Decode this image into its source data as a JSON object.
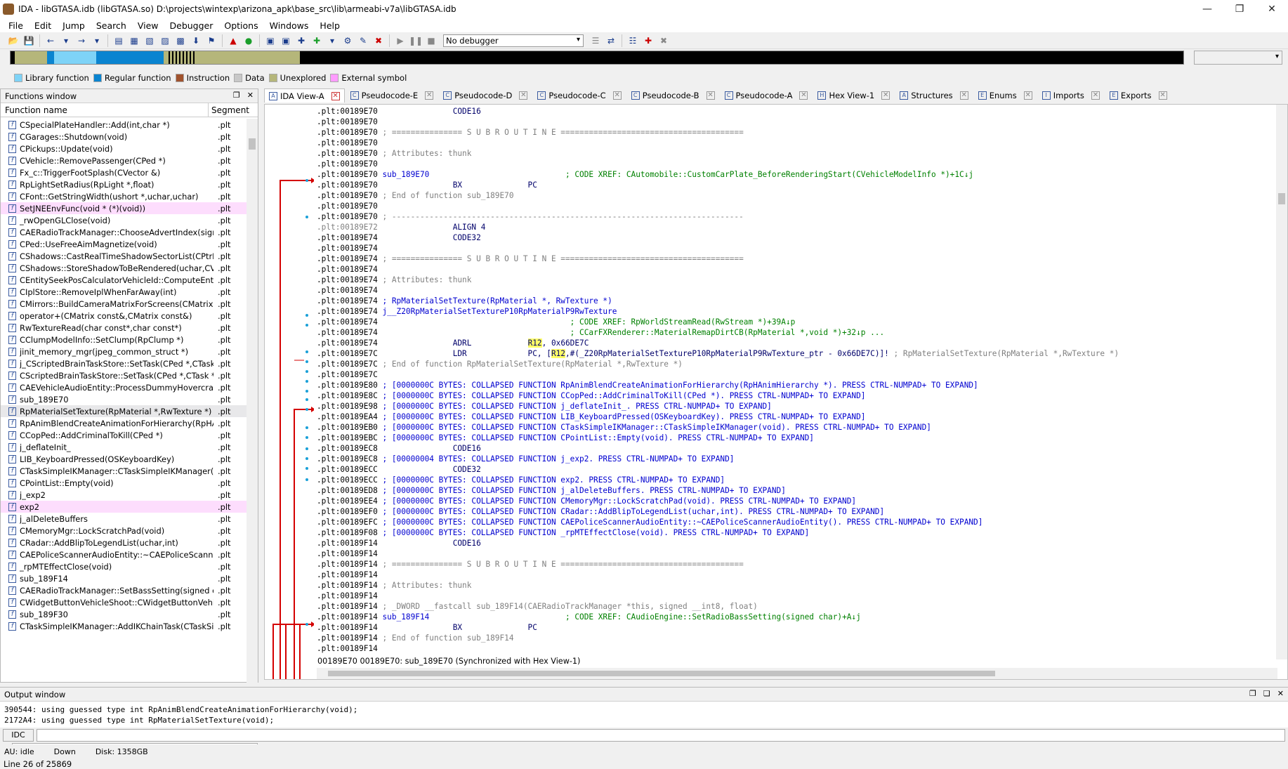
{
  "window": {
    "title": "IDA - libGTASA.idb (libGTASA.so) D:\\projects\\wintexp\\arizona_apk\\base_src\\lib\\armeabi-v7a\\libGTASA.idb"
  },
  "menu": [
    "File",
    "Edit",
    "Jump",
    "Search",
    "View",
    "Debugger",
    "Options",
    "Windows",
    "Help"
  ],
  "toolbar": {
    "debugger_select": "No debugger"
  },
  "legend": [
    {
      "label": "Library function",
      "color": "#7ed3f7"
    },
    {
      "label": "Regular function",
      "color": "#0a84d0"
    },
    {
      "label": "Instruction",
      "color": "#a0522d"
    },
    {
      "label": "Data",
      "color": "#c8c8c8"
    },
    {
      "label": "Unexplored",
      "color": "#b5b67a"
    },
    {
      "label": "External symbol",
      "color": "#ff9cff"
    }
  ],
  "functions_window": {
    "title": "Functions window",
    "col_name": "Function name",
    "col_segment": "Segment",
    "status": "Line 26 of 25869",
    "rows": [
      {
        "name": "CSpecialPlateHandler::Add(int,char *)",
        "seg": ".plt",
        "hl": ""
      },
      {
        "name": "CGarages::Shutdown(void)",
        "seg": ".plt",
        "hl": ""
      },
      {
        "name": "CPickups::Update(void)",
        "seg": ".plt",
        "hl": ""
      },
      {
        "name": "CVehicle::RemovePassenger(CPed *)",
        "seg": ".plt",
        "hl": ""
      },
      {
        "name": "Fx_c::TriggerFootSplash(CVector &)",
        "seg": ".plt",
        "hl": ""
      },
      {
        "name": "RpLightSetRadius(RpLight *,float)",
        "seg": ".plt",
        "hl": ""
      },
      {
        "name": "CFont::GetStringWidth(ushort *,uchar,uchar)",
        "seg": ".plt",
        "hl": ""
      },
      {
        "name": "SetJNEEnvFunc(void * (*)(void))",
        "seg": ".plt",
        "hl": "pink"
      },
      {
        "name": "_rwOpenGLClose(void)",
        "seg": ".plt",
        "hl": ""
      },
      {
        "name": "CAERadioTrackManager::ChooseAdvertIndex(signe...",
        "seg": ".plt",
        "hl": ""
      },
      {
        "name": "CPed::UseFreeAimMagnetize(void)",
        "seg": ".plt",
        "hl": ""
      },
      {
        "name": "CShadows::CastRealTimeShadowSectorList(CPtrList ...",
        "seg": ".plt",
        "hl": ""
      },
      {
        "name": "CShadows::StoreShadowToBeRendered(uchar,CVec...",
        "seg": ".plt",
        "hl": ""
      },
      {
        "name": "CEntitySeekPosCalculatorVehicleId::ComputeEntityS...",
        "seg": ".plt",
        "hl": ""
      },
      {
        "name": "CIplStore::RemoveIplWhenFarAway(int)",
        "seg": ".plt",
        "hl": ""
      },
      {
        "name": "CMirrors::BuildCameraMatrixForScreens(CMatrix *)",
        "seg": ".plt",
        "hl": ""
      },
      {
        "name": "operator+(CMatrix const&,CMatrix const&)",
        "seg": ".plt",
        "hl": ""
      },
      {
        "name": "RwTextureRead(char const*,char const*)",
        "seg": ".plt",
        "hl": ""
      },
      {
        "name": "CClumpModelInfo::SetClump(RpClump *)",
        "seg": ".plt",
        "hl": ""
      },
      {
        "name": "jinit_memory_mgr(jpeg_common_struct *)",
        "seg": ".plt",
        "hl": ""
      },
      {
        "name": "j_CScriptedBrainTaskStore::SetTask(CPed *,CTask *)",
        "seg": ".plt",
        "hl": ""
      },
      {
        "name": "CScriptedBrainTaskStore::SetTask(CPed *,CTask *)",
        "seg": ".plt",
        "hl": ""
      },
      {
        "name": "CAEVehicleAudioEntity::ProcessDummyHovercraft(C...",
        "seg": ".plt",
        "hl": ""
      },
      {
        "name": "sub_189E70",
        "seg": ".plt",
        "hl": ""
      },
      {
        "name": "RpMaterialSetTexture(RpMaterial *,RwTexture *)",
        "seg": ".plt",
        "hl": "sel"
      },
      {
        "name": "RpAnimBlendCreateAnimationForHierarchy(RpHAnim...",
        "seg": ".plt",
        "hl": ""
      },
      {
        "name": "CCopPed::AddCriminalToKill(CPed *)",
        "seg": ".plt",
        "hl": ""
      },
      {
        "name": "j_deflateInit_",
        "seg": ".plt",
        "hl": ""
      },
      {
        "name": "LIB_KeyboardPressed(OSKeyboardKey)",
        "seg": ".plt",
        "hl": ""
      },
      {
        "name": "CTaskSimpleIKManager::CTaskSimpleIKManager(void)",
        "seg": ".plt",
        "hl": ""
      },
      {
        "name": "CPointList::Empty(void)",
        "seg": ".plt",
        "hl": ""
      },
      {
        "name": "j_exp2",
        "seg": ".plt",
        "hl": ""
      },
      {
        "name": "exp2",
        "seg": ".plt",
        "hl": "pink"
      },
      {
        "name": "j_alDeleteBuffers",
        "seg": ".plt",
        "hl": ""
      },
      {
        "name": "CMemoryMgr::LockScratchPad(void)",
        "seg": ".plt",
        "hl": ""
      },
      {
        "name": "CRadar::AddBlipToLegendList(uchar,int)",
        "seg": ".plt",
        "hl": ""
      },
      {
        "name": "CAEPoliceScannerAudioEntity::~CAEPoliceScannerA...",
        "seg": ".plt",
        "hl": ""
      },
      {
        "name": "_rpMTEffectClose(void)",
        "seg": ".plt",
        "hl": ""
      },
      {
        "name": "sub_189F14",
        "seg": ".plt",
        "hl": ""
      },
      {
        "name": "CAERadioTrackManager::SetBassSetting(signed char...",
        "seg": ".plt",
        "hl": ""
      },
      {
        "name": "CWidgetButtonVehicleShoot::CWidgetButtonVehicleS...",
        "seg": ".plt",
        "hl": ""
      },
      {
        "name": "sub_189F30",
        "seg": ".plt",
        "hl": ""
      },
      {
        "name": "CTaskSimpleIKManager::AddIKChainTask(CTaskSimpl...",
        "seg": ".plt",
        "hl": ""
      }
    ]
  },
  "tabs": [
    {
      "label": "IDA View-A",
      "icon": "ida-view",
      "active": true
    },
    {
      "label": "Pseudocode-E",
      "icon": "pseudocode"
    },
    {
      "label": "Pseudocode-D",
      "icon": "pseudocode"
    },
    {
      "label": "Pseudocode-C",
      "icon": "pseudocode"
    },
    {
      "label": "Pseudocode-B",
      "icon": "pseudocode"
    },
    {
      "label": "Pseudocode-A",
      "icon": "pseudocode"
    },
    {
      "label": "Hex View-1",
      "icon": "hex"
    },
    {
      "label": "Structures",
      "icon": "struct"
    },
    {
      "label": "Enums",
      "icon": "enum"
    },
    {
      "label": "Imports",
      "icon": "imports"
    },
    {
      "label": "Exports",
      "icon": "exports"
    }
  ],
  "disasm": [
    [
      {
        "t": ".plt:00189E70",
        "c": "ad"
      },
      {
        "t": "                CODE16",
        "c": "codeblue"
      }
    ],
    [
      {
        "t": ".plt:00189E70",
        "c": "ad"
      }
    ],
    [
      {
        "t": ".plt:00189E70",
        "c": "ad"
      },
      {
        "t": " ; =============== S U B R O U T I N E =======================================",
        "c": "cm"
      }
    ],
    [
      {
        "t": ".plt:00189E70",
        "c": "ad"
      }
    ],
    [
      {
        "t": ".plt:00189E70",
        "c": "ad"
      },
      {
        "t": " ; Attributes: thunk",
        "c": "cm"
      }
    ],
    [
      {
        "t": ".plt:00189E70",
        "c": "ad"
      }
    ],
    [
      {
        "t": ".plt:00189E70",
        "c": "ad"
      },
      {
        "t": " sub_189E70",
        "c": "blue"
      },
      {
        "t": "                             ; CODE XREF: CAutomobile::CustomCarPlate_BeforeRenderingStart(CVehicleModelInfo *)+1C↓j",
        "c": "xr"
      }
    ],
    [
      {
        "t": ".plt:00189E70",
        "c": "ad"
      },
      {
        "t": "                BX              PC",
        "c": "codeblue"
      }
    ],
    [
      {
        "t": ".plt:00189E70",
        "c": "ad"
      },
      {
        "t": " ; End of function sub_189E70",
        "c": "cm"
      }
    ],
    [
      {
        "t": ".plt:00189E70",
        "c": "ad"
      }
    ],
    [
      {
        "t": ".plt:00189E70",
        "c": "ad"
      },
      {
        "t": " ; ---------------------------------------------------------------------------",
        "c": "cm"
      }
    ],
    [
      {
        "t": ".plt:00189E72",
        "c": "ad grey"
      },
      {
        "t": "                ALIGN 4",
        "c": "codeblue"
      }
    ],
    [
      {
        "t": ".plt:00189E74",
        "c": "ad"
      },
      {
        "t": "                CODE32",
        "c": "codeblue"
      }
    ],
    [
      {
        "t": ".plt:00189E74",
        "c": "ad"
      }
    ],
    [
      {
        "t": ".plt:00189E74",
        "c": "ad"
      },
      {
        "t": " ; =============== S U B R O U T I N E =======================================",
        "c": "cm"
      }
    ],
    [
      {
        "t": ".plt:00189E74",
        "c": "ad"
      }
    ],
    [
      {
        "t": ".plt:00189E74",
        "c": "ad"
      },
      {
        "t": " ; Attributes: thunk",
        "c": "cm"
      }
    ],
    [
      {
        "t": ".plt:00189E74",
        "c": "ad"
      }
    ],
    [
      {
        "t": ".plt:00189E74",
        "c": "ad"
      },
      {
        "t": " ; RpMaterialSetTexture(RpMaterial *, RwTexture *)",
        "c": "blue"
      }
    ],
    [
      {
        "t": ".plt:00189E74",
        "c": "ad"
      },
      {
        "t": " j__Z20RpMaterialSetTextureP10RpMaterialP9RwTexture",
        "c": "blue"
      }
    ],
    [
      {
        "t": ".plt:00189E74",
        "c": "ad"
      },
      {
        "t": "                                         ; CODE XREF: RpWorldStreamRead(RwStream *)+39A↓p",
        "c": "xr"
      }
    ],
    [
      {
        "t": ".plt:00189E74",
        "c": "ad"
      },
      {
        "t": "                                         ; CCarFXRenderer::MaterialRemapDirtCB(RpMaterial *,void *)+32↓p ...",
        "c": "xr"
      }
    ],
    [
      {
        "t": ".plt:00189E74",
        "c": "ad"
      },
      {
        "t": "                ADRL            ",
        "c": "codeblue"
      },
      {
        "t": "R12",
        "c": "codeblue hl"
      },
      {
        "t": ", 0x66DE7C",
        "c": "codeblue"
      }
    ],
    [
      {
        "t": ".plt:00189E7C",
        "c": "ad"
      },
      {
        "t": "                LDR             PC, [",
        "c": "codeblue"
      },
      {
        "t": "R12",
        "c": "codeblue hl"
      },
      {
        "t": ",#(_Z20RpMaterialSetTextureP10RpMaterialP9RwTexture_ptr - 0x66DE7C)]! ",
        "c": "codeblue"
      },
      {
        "t": "; RpMaterialSetTexture(RpMaterial *,RwTexture *)",
        "c": "cm"
      }
    ],
    [
      {
        "t": ".plt:00189E7C",
        "c": "ad"
      },
      {
        "t": " ; End of function RpMaterialSetTexture(RpMaterial *,RwTexture *)",
        "c": "cm"
      }
    ],
    [
      {
        "t": ".plt:00189E7C",
        "c": "ad"
      }
    ],
    [
      {
        "t": ".plt:00189E80",
        "c": "ad"
      },
      {
        "t": " ; [0000000C BYTES: COLLAPSED FUNCTION RpAnimBlendCreateAnimationForHierarchy(RpHAnimHierarchy *). PRESS CTRL-NUMPAD+ TO EXPAND]",
        "c": "blue"
      }
    ],
    [
      {
        "t": ".plt:00189E8C",
        "c": "ad"
      },
      {
        "t": " ; [0000000C BYTES: COLLAPSED FUNCTION CCopPed::AddCriminalToKill(CPed *). PRESS CTRL-NUMPAD+ TO EXPAND]",
        "c": "blue"
      }
    ],
    [
      {
        "t": ".plt:00189E98",
        "c": "ad"
      },
      {
        "t": " ; [0000000C BYTES: COLLAPSED FUNCTION j_deflateInit_. PRESS CTRL-NUMPAD+ TO EXPAND]",
        "c": "blue"
      }
    ],
    [
      {
        "t": ".plt:00189EA4",
        "c": "ad"
      },
      {
        "t": " ; [0000000C BYTES: COLLAPSED FUNCTION LIB_KeyboardPressed(OSKeyboardKey). PRESS CTRL-NUMPAD+ TO EXPAND]",
        "c": "blue"
      }
    ],
    [
      {
        "t": ".plt:00189EB0",
        "c": "ad"
      },
      {
        "t": " ; [0000000C BYTES: COLLAPSED FUNCTION CTaskSimpleIKManager::CTaskSimpleIKManager(void). PRESS CTRL-NUMPAD+ TO EXPAND]",
        "c": "blue"
      }
    ],
    [
      {
        "t": ".plt:00189EBC",
        "c": "ad"
      },
      {
        "t": " ; [0000000C BYTES: COLLAPSED FUNCTION CPointList::Empty(void). PRESS CTRL-NUMPAD+ TO EXPAND]",
        "c": "blue"
      }
    ],
    [
      {
        "t": ".plt:00189EC8",
        "c": "ad"
      },
      {
        "t": "                CODE16",
        "c": "codeblue"
      }
    ],
    [
      {
        "t": ".plt:00189EC8",
        "c": "ad"
      },
      {
        "t": " ; [00000004 BYTES: COLLAPSED FUNCTION j_exp2. PRESS CTRL-NUMPAD+ TO EXPAND]",
        "c": "blue"
      }
    ],
    [
      {
        "t": ".plt:00189ECC",
        "c": "ad"
      },
      {
        "t": "                CODE32",
        "c": "codeblue"
      }
    ],
    [
      {
        "t": ".plt:00189ECC",
        "c": "ad"
      },
      {
        "t": " ; [0000000C BYTES: COLLAPSED FUNCTION exp2. PRESS CTRL-NUMPAD+ TO EXPAND]",
        "c": "blue"
      }
    ],
    [
      {
        "t": ".plt:00189ED8",
        "c": "ad"
      },
      {
        "t": " ; [0000000C BYTES: COLLAPSED FUNCTION j_alDeleteBuffers. PRESS CTRL-NUMPAD+ TO EXPAND]",
        "c": "blue"
      }
    ],
    [
      {
        "t": ".plt:00189EE4",
        "c": "ad"
      },
      {
        "t": " ; [0000000C BYTES: COLLAPSED FUNCTION CMemoryMgr::LockScratchPad(void). PRESS CTRL-NUMPAD+ TO EXPAND]",
        "c": "blue"
      }
    ],
    [
      {
        "t": ".plt:00189EF0",
        "c": "ad"
      },
      {
        "t": " ; [0000000C BYTES: COLLAPSED FUNCTION CRadar::AddBlipToLegendList(uchar,int). PRESS CTRL-NUMPAD+ TO EXPAND]",
        "c": "blue"
      }
    ],
    [
      {
        "t": ".plt:00189EFC",
        "c": "ad"
      },
      {
        "t": " ; [0000000C BYTES: COLLAPSED FUNCTION CAEPoliceScannerAudioEntity::~CAEPoliceScannerAudioEntity(). PRESS CTRL-NUMPAD+ TO EXPAND]",
        "c": "blue"
      }
    ],
    [
      {
        "t": ".plt:00189F08",
        "c": "ad"
      },
      {
        "t": " ; [0000000C BYTES: COLLAPSED FUNCTION _rpMTEffectClose(void). PRESS CTRL-NUMPAD+ TO EXPAND]",
        "c": "blue"
      }
    ],
    [
      {
        "t": ".plt:00189F14",
        "c": "ad"
      },
      {
        "t": "                CODE16",
        "c": "codeblue"
      }
    ],
    [
      {
        "t": ".plt:00189F14",
        "c": "ad"
      }
    ],
    [
      {
        "t": ".plt:00189F14",
        "c": "ad"
      },
      {
        "t": " ; =============== S U B R O U T I N E =======================================",
        "c": "cm"
      }
    ],
    [
      {
        "t": ".plt:00189F14",
        "c": "ad"
      }
    ],
    [
      {
        "t": ".plt:00189F14",
        "c": "ad"
      },
      {
        "t": " ; Attributes: thunk",
        "c": "cm"
      }
    ],
    [
      {
        "t": ".plt:00189F14",
        "c": "ad"
      }
    ],
    [
      {
        "t": ".plt:00189F14",
        "c": "ad"
      },
      {
        "t": " ; _DWORD __fastcall sub_189F14(CAERadioTrackManager *this, signed __int8, float)",
        "c": "cm"
      }
    ],
    [
      {
        "t": ".plt:00189F14",
        "c": "ad"
      },
      {
        "t": " sub_189F14",
        "c": "blue"
      },
      {
        "t": "                             ; CODE XREF: CAudioEngine::SetRadioBassSetting(signed char)+A↓j",
        "c": "xr"
      }
    ],
    [
      {
        "t": ".plt:00189F14",
        "c": "ad"
      },
      {
        "t": "                BX              PC",
        "c": "codeblue"
      }
    ],
    [
      {
        "t": ".plt:00189F14",
        "c": "ad"
      },
      {
        "t": " ; End of function sub_189F14",
        "c": "cm"
      }
    ],
    [
      {
        "t": ".plt:00189F14",
        "c": "ad"
      }
    ]
  ],
  "view_status": "00189E70 00189E70: sub_189E70 (Synchronized with Hex View-1)",
  "output": {
    "title": "Output window",
    "lines": [
      "390544: using guessed type int RpAnimBlendCreateAnimationForHierarchy(void);",
      "2172A4: using guessed type int RpMaterialSetTexture(void);"
    ],
    "cmd_label": "IDC"
  },
  "status": {
    "au": "AU:  idle",
    "dir": "Down",
    "disk": "Disk: 1358GB"
  }
}
